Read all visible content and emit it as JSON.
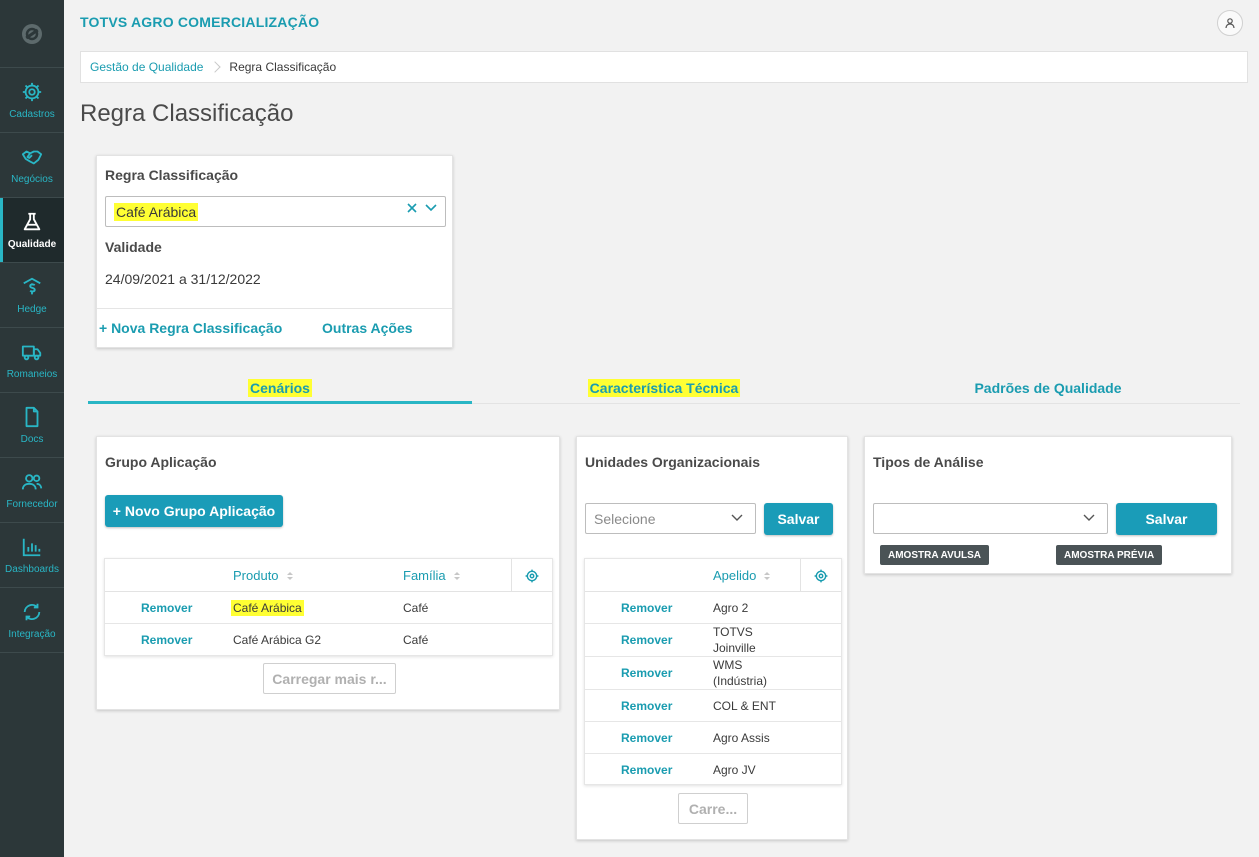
{
  "app": {
    "title": "TOTVS AGRO COMERCIALIZAÇÃO"
  },
  "sidebar": {
    "items": [
      {
        "label": "Cadastros",
        "icon": "gear-icon"
      },
      {
        "label": "Negócios",
        "icon": "handshake-icon"
      },
      {
        "label": "Qualidade",
        "icon": "flask-icon",
        "active": true
      },
      {
        "label": "Hedge",
        "icon": "dollar-icon"
      },
      {
        "label": "Romaneios",
        "icon": "truck-icon"
      },
      {
        "label": "Docs",
        "icon": "document-icon"
      },
      {
        "label": "Fornecedor",
        "icon": "users-icon"
      },
      {
        "label": "Dashboards",
        "icon": "bar-chart-icon"
      },
      {
        "label": "Integração",
        "icon": "sync-icon"
      }
    ]
  },
  "breadcrumb": {
    "parent": "Gestão de Qualidade",
    "current": "Regra Classificação"
  },
  "page": {
    "title": "Regra Classificação"
  },
  "rule_card": {
    "label": "Regra Classificação",
    "selected": "Café Arábica",
    "validity_label": "Validade",
    "validity_value": "24/09/2021 a 31/12/2022",
    "new_rule_link": "+ Nova Regra Classificação",
    "other_actions_link": "Outras Ações"
  },
  "tabs": [
    {
      "label": "Cenários",
      "active": true
    },
    {
      "label": "Característica Técnica"
    },
    {
      "label": "Padrões de Qualidade"
    }
  ],
  "grupo": {
    "title": "Grupo Aplicação",
    "new_button": "+ Novo Grupo Aplicação",
    "columns": {
      "produto": "Produto",
      "familia": "Família"
    },
    "rows": [
      {
        "action": "Remover",
        "produto": "Café Arábica",
        "familia": "Café"
      },
      {
        "action": "Remover",
        "produto": "Café Arábica G2",
        "familia": "Café"
      }
    ],
    "load_more": "Carregar mais r..."
  },
  "unidades": {
    "title": "Unidades Organizacionais",
    "select_placeholder": "Selecione",
    "save_button": "Salvar",
    "columns": {
      "apelido": "Apelido"
    },
    "rows": [
      {
        "action": "Remover",
        "line1": "Agro 2",
        "line2": ""
      },
      {
        "action": "Remover",
        "line1": "TOTVS",
        "line2": "Joinville"
      },
      {
        "action": "Remover",
        "line1": "WMS",
        "line2": "(Indústria)"
      },
      {
        "action": "Remover",
        "line1": "COL & ENT",
        "line2": ""
      },
      {
        "action": "Remover",
        "line1": "Agro Assis",
        "line2": ""
      },
      {
        "action": "Remover",
        "line1": "Agro JV",
        "line2": ""
      }
    ],
    "load_more": "Carre..."
  },
  "tipos": {
    "title": "Tipos de Análise",
    "select_value": "",
    "save_button": "Salvar",
    "tags": [
      "AMOSTRA AVULSA",
      "AMOSTRA PRÉVIA"
    ]
  },
  "colors": {
    "accent": "#1a9cb0",
    "sidebar": "#2c3739",
    "highlight": "#ffff33"
  }
}
